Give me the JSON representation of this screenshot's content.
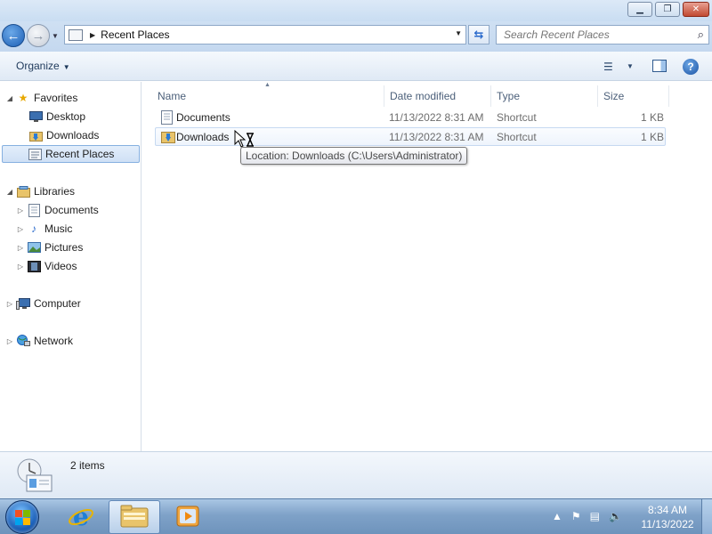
{
  "window": {
    "minimize_label": "▁",
    "maximize_label": "❐",
    "close_label": "✕"
  },
  "address": {
    "location": "Recent Places",
    "search_placeholder": "Search Recent Places"
  },
  "toolbar": {
    "organize_label": "Organize"
  },
  "nav": {
    "favorites": {
      "label": "Favorites",
      "items": [
        {
          "label": "Desktop",
          "icon": "desktop-icon"
        },
        {
          "label": "Downloads",
          "icon": "downloads-folder-icon"
        },
        {
          "label": "Recent Places",
          "icon": "recent-places-icon",
          "selected": true
        }
      ]
    },
    "libraries": {
      "label": "Libraries",
      "items": [
        {
          "label": "Documents",
          "icon": "documents-icon"
        },
        {
          "label": "Music",
          "icon": "music-icon"
        },
        {
          "label": "Pictures",
          "icon": "pictures-icon"
        },
        {
          "label": "Videos",
          "icon": "videos-icon"
        }
      ]
    },
    "computer": {
      "label": "Computer",
      "icon": "computer-icon"
    },
    "network": {
      "label": "Network",
      "icon": "network-icon"
    }
  },
  "columns": {
    "name": "Name",
    "date": "Date modified",
    "type": "Type",
    "size": "Size"
  },
  "files": [
    {
      "name": "Documents",
      "date": "11/13/2022 8:31 AM",
      "type": "Shortcut",
      "size": "1 KB",
      "icon": "documents-shortcut-icon"
    },
    {
      "name": "Downloads",
      "date": "11/13/2022 8:31 AM",
      "type": "Shortcut",
      "size": "1 KB",
      "icon": "downloads-shortcut-icon"
    }
  ],
  "tooltip": "Location: Downloads (C:\\Users\\Administrator)",
  "details": {
    "item_count": "2 items"
  },
  "taskbar": {
    "apps": [
      "internet-explorer-icon",
      "windows-explorer-icon",
      "media-player-icon"
    ],
    "time": "8:34 AM",
    "date": "11/13/2022"
  },
  "colors": {
    "accent": "#1d5fb5",
    "selection_bg": "#cfe0f5",
    "taskbar": "#7fa2c8"
  }
}
